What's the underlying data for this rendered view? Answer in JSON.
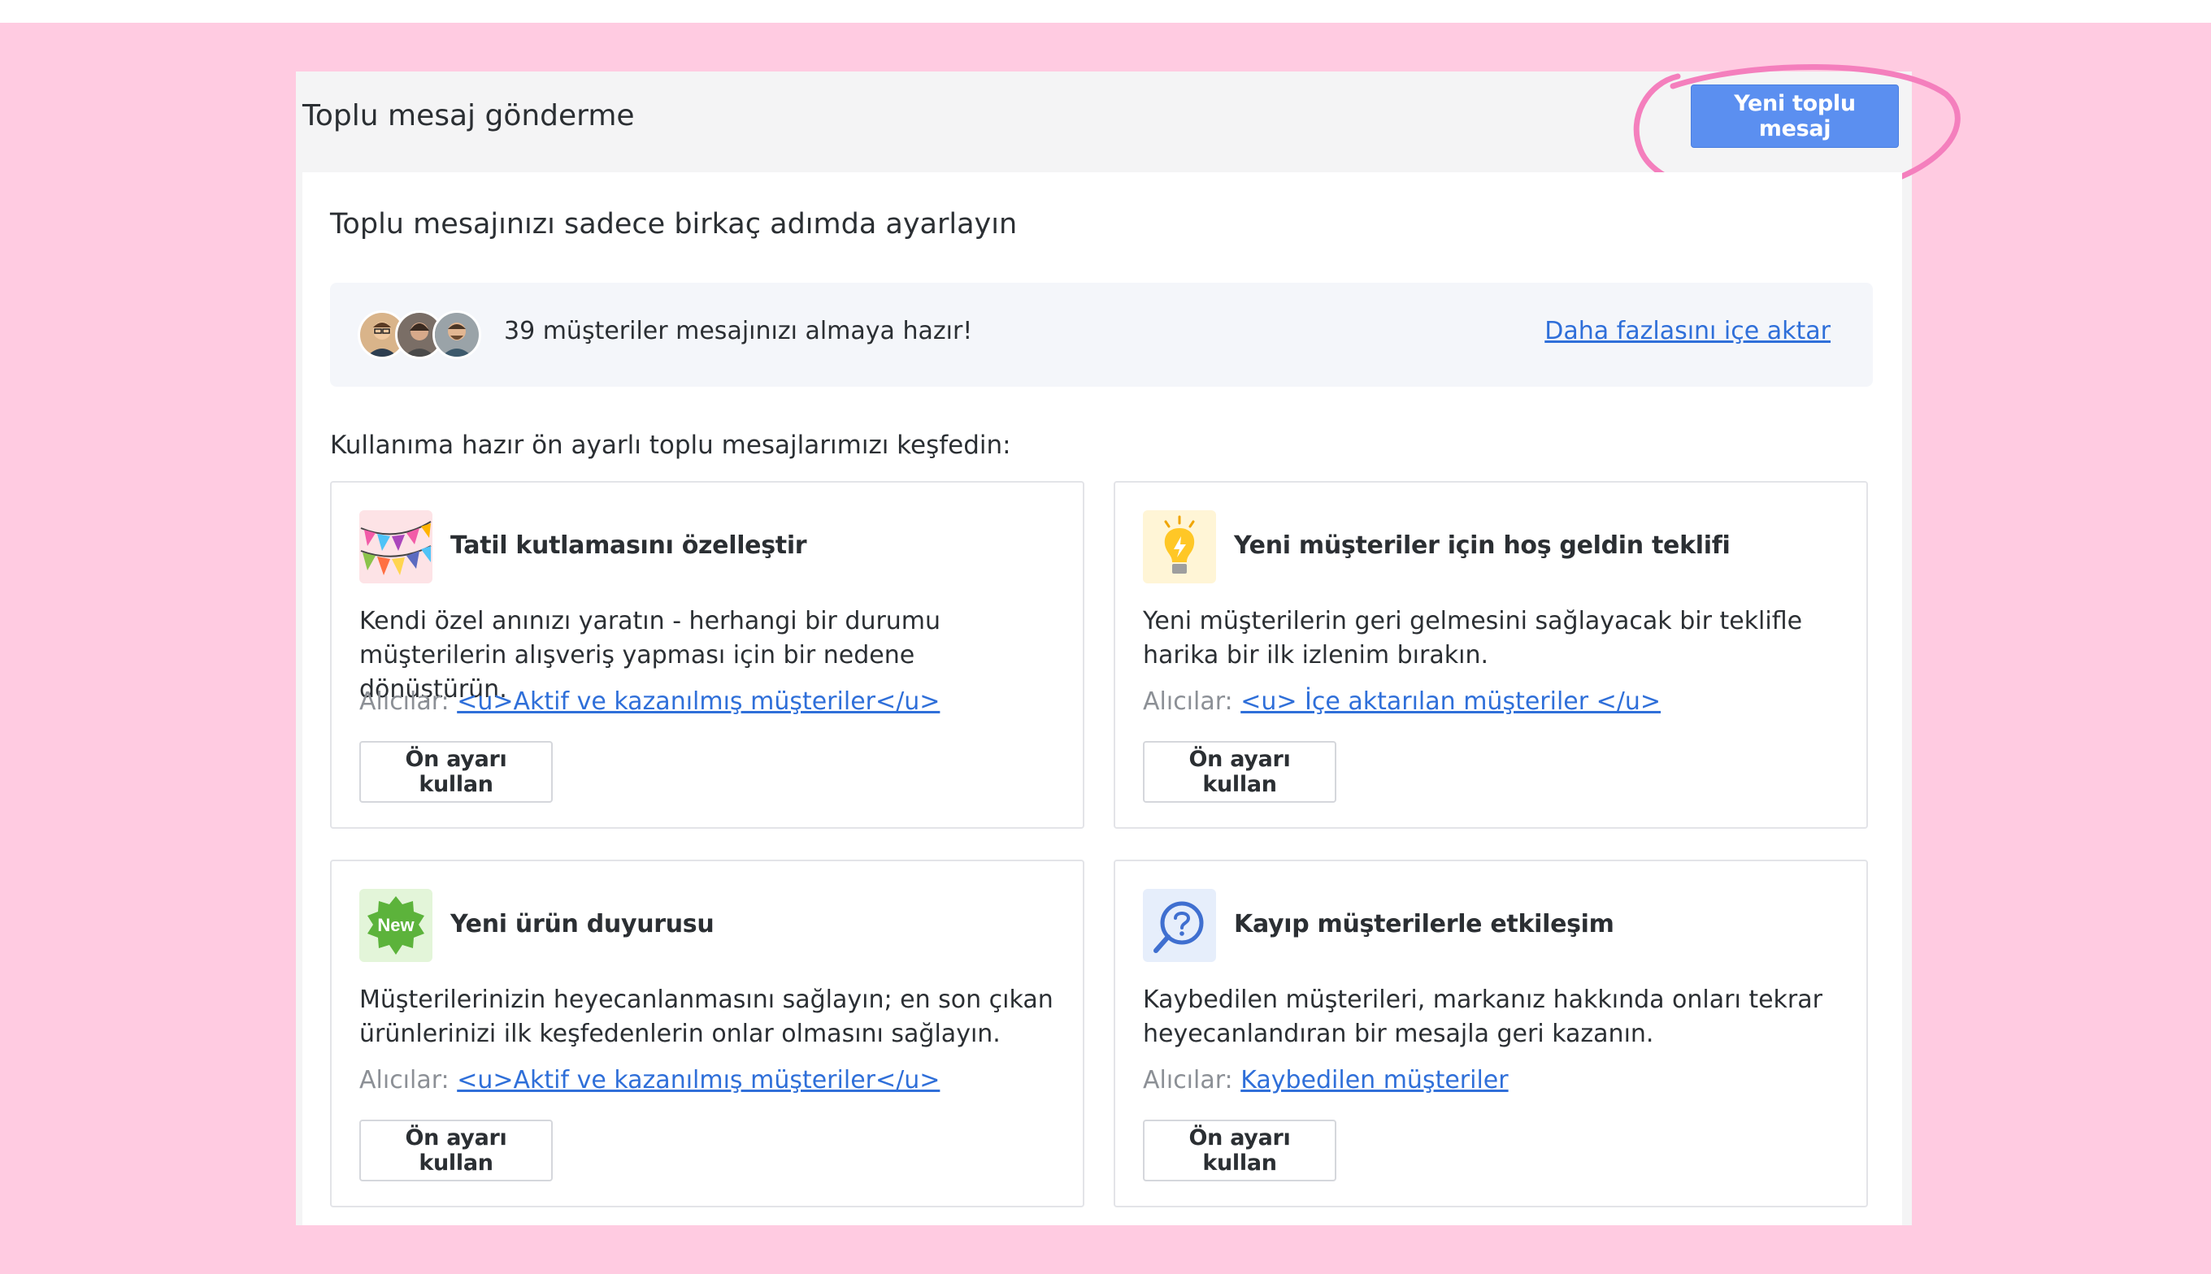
{
  "header": {
    "title": "Toplu mesaj gönderme",
    "new_button_label": "Yeni toplu mesaj"
  },
  "main": {
    "subtitle": "Toplu mesajınızı sadece birkaç adımda ayarlayın",
    "banner": {
      "text": "39 müşteriler mesajınızı almaya hazır!",
      "link": "Daha fazlasını içe aktar"
    },
    "explore_text": "Kullanıma hazır ön ayarlı toplu mesajlarımızı keşfedin:",
    "recipients_label": "Alıcılar:",
    "presets": [
      {
        "icon": "bunting-flags-icon",
        "title": "Tatil kutlamasını özelleştir",
        "description": "Kendi özel anınızı yaratın - herhangi bir durumu müşterilerin alışveriş yapması için bir nedene dönüştürün.",
        "recipients": "<u>Aktif ve kazanılmış müşteriler</u>",
        "button": "Ön ayarı kullan"
      },
      {
        "icon": "lightbulb-icon",
        "title": "Yeni müşteriler için hoş geldin teklifi",
        "description": "Yeni müşterilerin geri gelmesini sağlayacak bir teklifle harika bir ilk izlenim bırakın.",
        "recipients": "<u> İçe aktarılan müşteriler </u>",
        "button": "Ön ayarı kullan"
      },
      {
        "icon": "new-badge-icon",
        "icon_text": "New",
        "title": "Yeni ürün duyurusu",
        "description": "Müşterilerinizin heyecanlanmasını sağlayın; en son çıkan ürünlerinizi ilk keşfedenlerin onlar olmasını sağlayın.",
        "recipients": "<u>Aktif ve kazanılmış müşteriler</u>",
        "button": "Ön ayarı kullan"
      },
      {
        "icon": "magnifier-question-icon",
        "title": "Kayıp müşterilerle etkileşim",
        "description": "Kaybedilen müşterileri, markanız hakkında onları tekrar heyecanlandıran bir mesajla geri kazanın.",
        "recipients": "Kaybedilen müşteriler",
        "button": "Ön ayarı kullan"
      }
    ]
  },
  "colors": {
    "background": "#ffcbe1",
    "primary": "#5b8ff0",
    "link": "#2f6fd9",
    "highlight": "#f47fbd"
  }
}
